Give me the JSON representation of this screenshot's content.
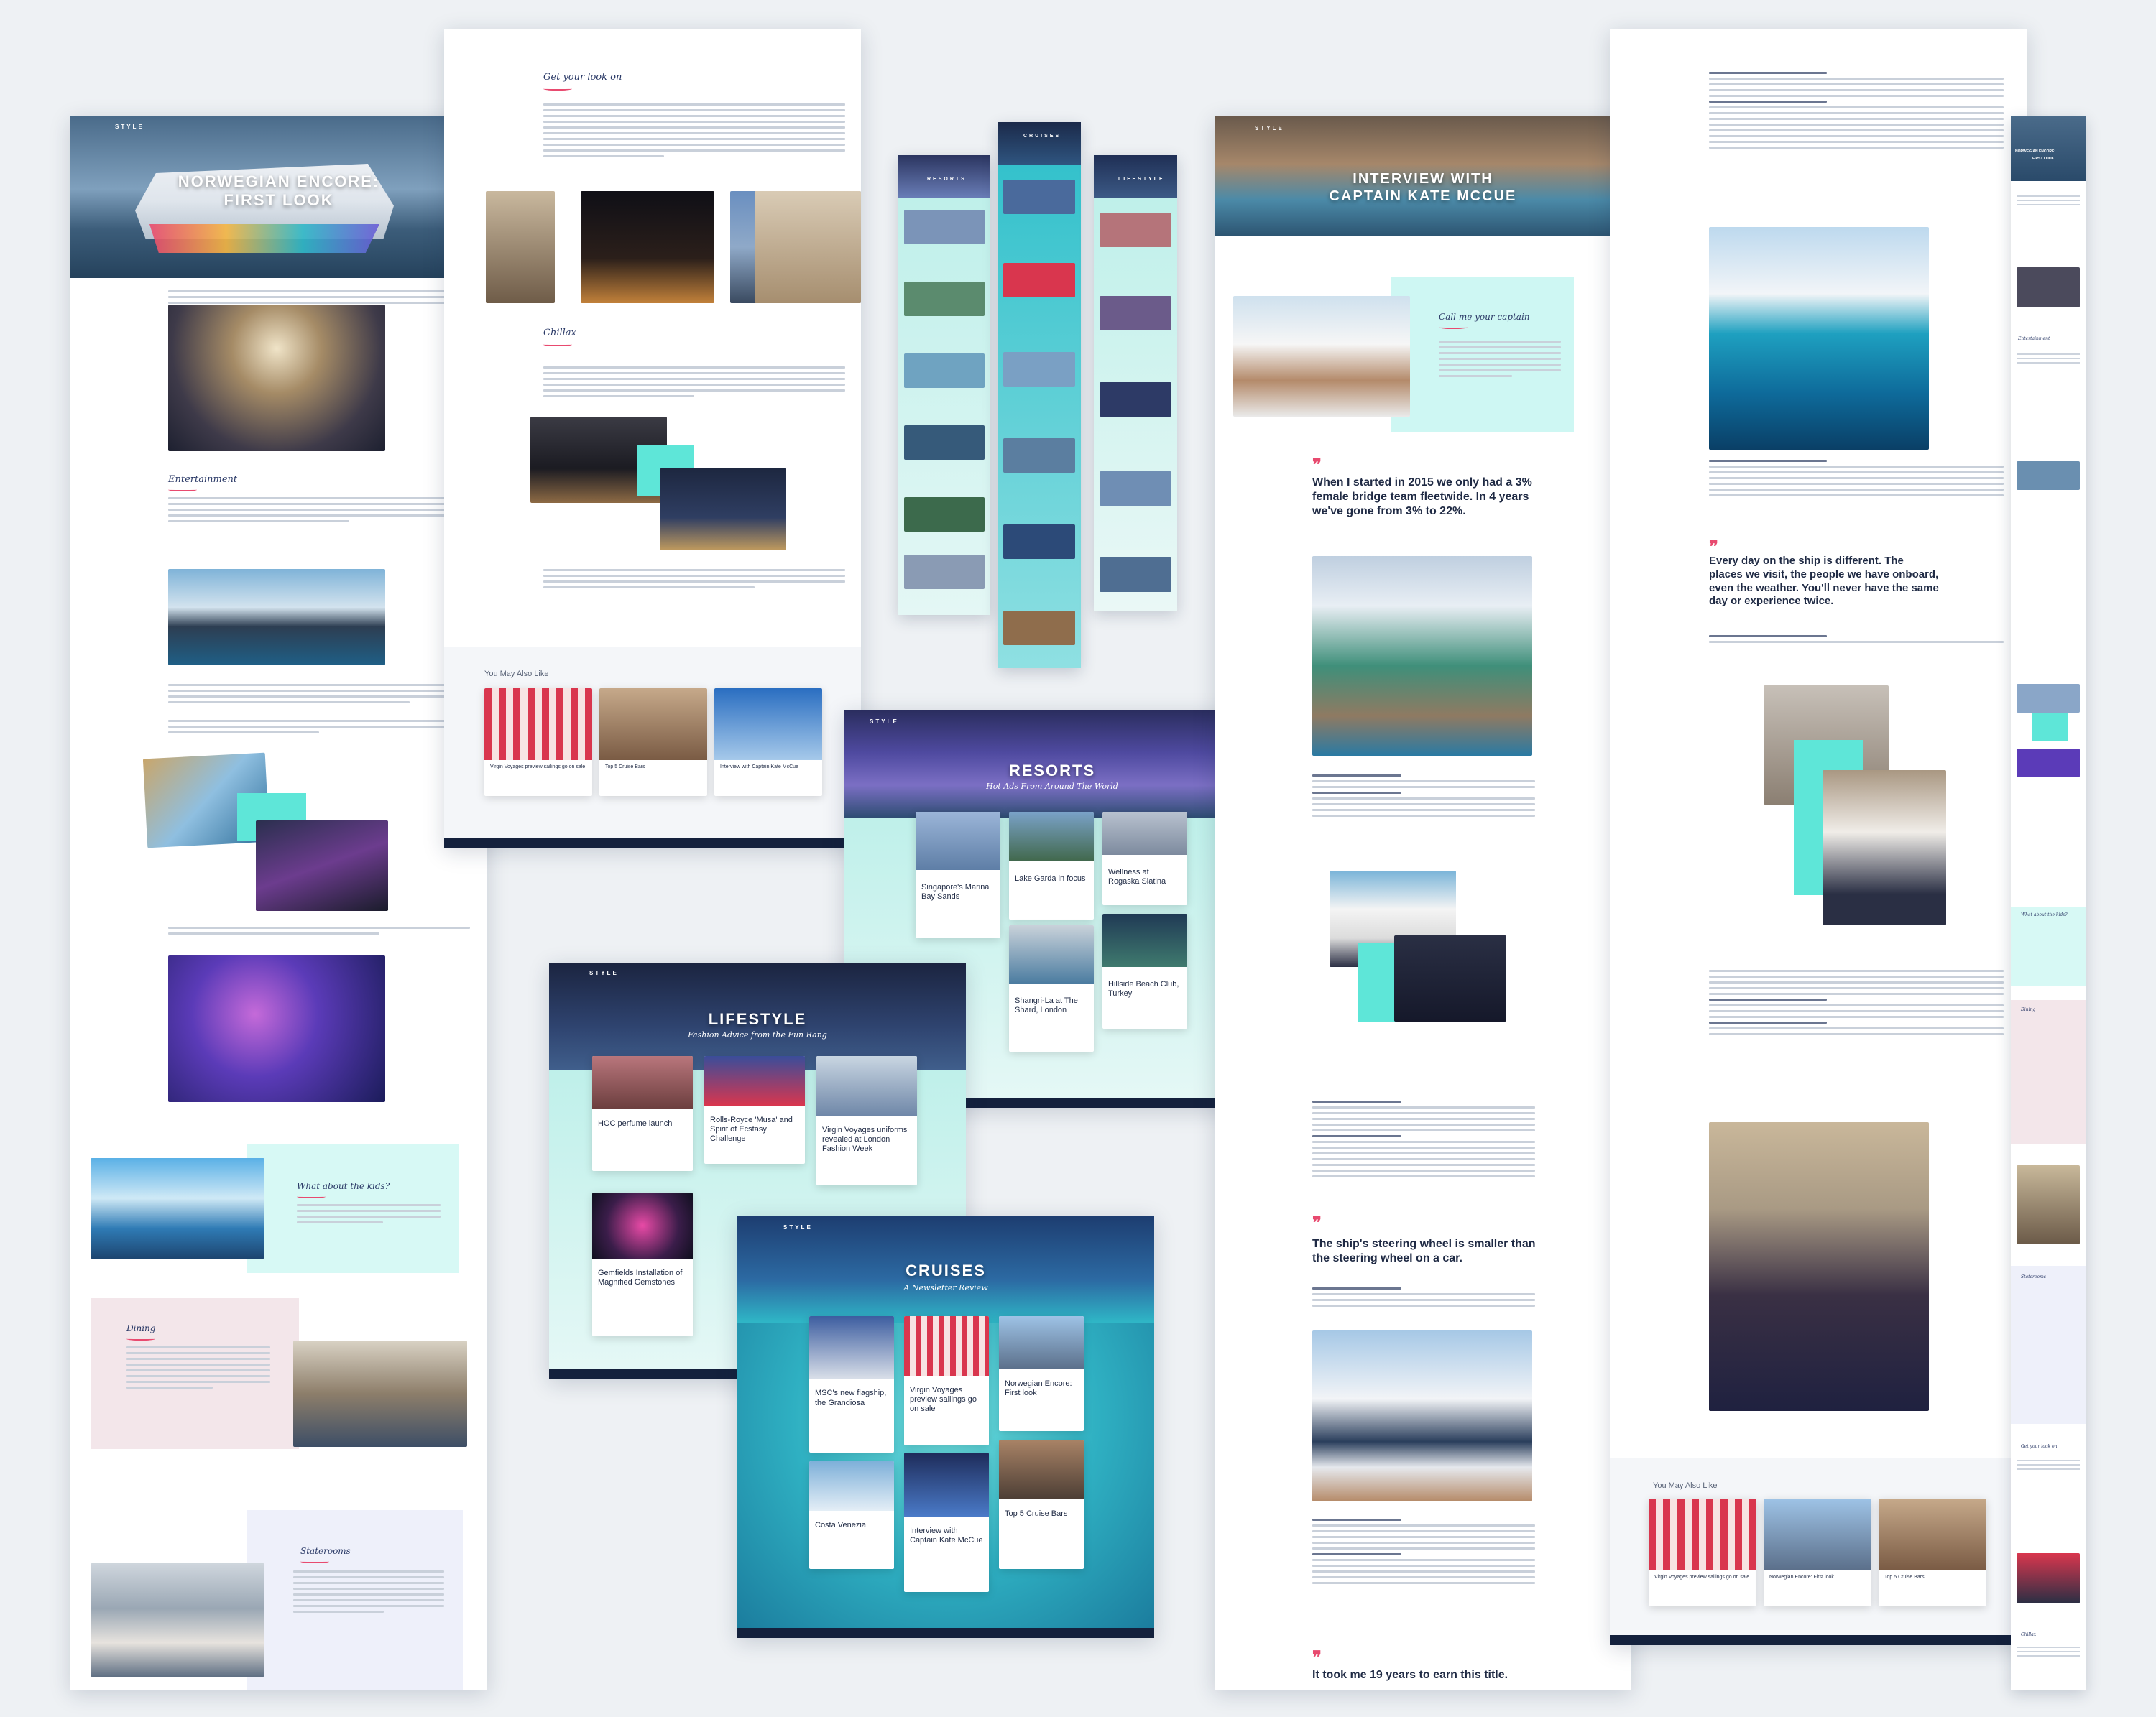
{
  "brand": {
    "logo": "STYLE"
  },
  "colors": {
    "accent_mint": "#5ee6d8",
    "accent_pink": "#e84a6f",
    "navy": "#14213d",
    "ocean": "#2fb8c7"
  },
  "panel_encore": {
    "hero_title_line1": "NORWEGIAN ENCORE:",
    "hero_title_line2": "FIRST LOOK",
    "section_entertainment": "Entertainment",
    "section_kids": "What about the kids?",
    "section_dining": "Dining",
    "section_staterooms": "Staterooms"
  },
  "panel_encore2": {
    "section_look": "Get your look on",
    "section_chill": "Chillax",
    "ymal_heading": "You May Also Like",
    "ymal_items": [
      "Virgin Voyages preview sailings go on sale",
      "Top 5 Cruise Bars",
      "Interview with Captain Kate McCue"
    ]
  },
  "columns": {
    "resorts_label": "RESORTS",
    "cruises_label": "CRUISES",
    "lifestyle_label": "LIFESTYLE"
  },
  "resorts_page": {
    "title": "RESORTS",
    "subtitle": "Hot Ads From Around The World",
    "cards": [
      {
        "title": "Singapore's Marina Bay Sands"
      },
      {
        "title": "Lake Garda in focus"
      },
      {
        "title": "Wellness at Rogaska Slatina"
      },
      {
        "title": "Shangri-La at The Shard, London"
      },
      {
        "title": "Hillside Beach Club, Turkey"
      }
    ]
  },
  "lifestyle_page": {
    "title": "LIFESTYLE",
    "subtitle": "Fashion Advice from the Fun Rang",
    "cards": [
      {
        "title": "HOC perfume launch"
      },
      {
        "title": "Rolls-Royce 'Musa' and Spirit of Ecstasy Challenge"
      },
      {
        "title": "Virgin Voyages uniforms revealed at London Fashion Week"
      },
      {
        "title": "Gemfields Installation of Magnified Gemstones"
      }
    ]
  },
  "cruises_page": {
    "title": "CRUISES",
    "subtitle": "A Newsletter Review",
    "cards": [
      {
        "title": "MSC's new flagship, the Grandiosa"
      },
      {
        "title": "Virgin Voyages preview sailings go on sale"
      },
      {
        "title": "Norwegian Encore: First look"
      },
      {
        "title": "Costa Venezia"
      },
      {
        "title": "Interview with Captain Kate McCue"
      },
      {
        "title": "Top 5 Cruise Bars"
      }
    ]
  },
  "interview": {
    "hero_title_line1": "INTERVIEW WITH",
    "hero_title_line2": "CAPTAIN KATE MCCUE",
    "intro_script": "Call me your captain",
    "quote1": "When I started in 2015 we only had a 3% female bridge team fleetwide. In 4 years we've gone from 3% to 22%.",
    "quote2": "The ship's steering wheel is smaller than the steering wheel on a car.",
    "quote3": "It took me 19 years to earn this title."
  },
  "interview2": {
    "quote": "Every day on the ship is different. The places we visit, the people we have onboard, even the weather. You'll never have the same day or experience twice.",
    "ymal_heading": "You May Also Like",
    "ymal_items": [
      "Virgin Voyages preview sailings go on sale",
      "Norwegian Encore: First look",
      "Top 5 Cruise Bars"
    ]
  },
  "mobile": {
    "title_line1": "NORWEGIAN ENCORE:",
    "title_line2": "FIRST LOOK",
    "sec1": "Entertainment",
    "sec2": "What about the kids?",
    "sec3": "Dining",
    "sec4": "Staterooms",
    "sec5": "Get your look on",
    "sec6": "Chillax"
  }
}
